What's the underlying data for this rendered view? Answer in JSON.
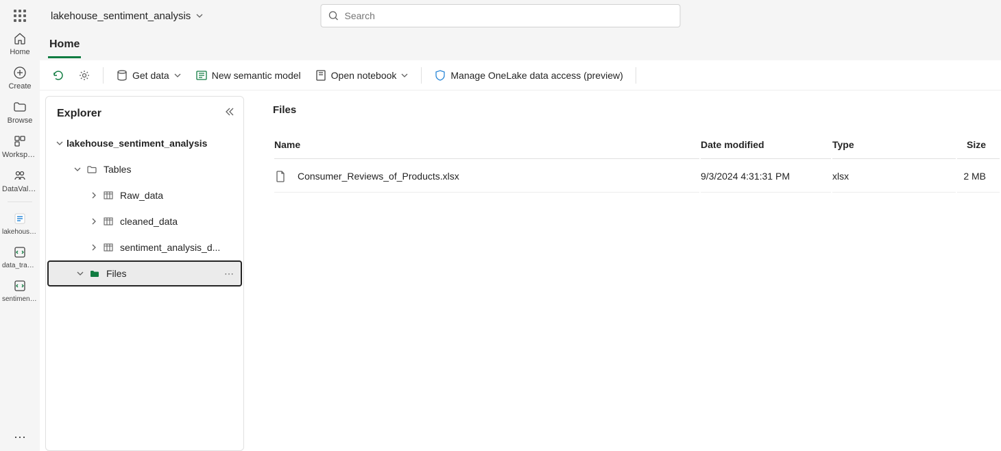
{
  "breadcrumb": {
    "title": "lakehouse_sentiment_analysis"
  },
  "search": {
    "placeholder": "Search"
  },
  "tabs": {
    "home": "Home"
  },
  "toolbar": {
    "get_data": "Get data",
    "new_semantic_model": "New semantic model",
    "open_notebook": "Open notebook",
    "manage_access": "Manage OneLake data access (preview)"
  },
  "leftrail": {
    "home": "Home",
    "create": "Create",
    "browse": "Browse",
    "workspaces": "Workspaces",
    "datavalue": "DataValue_Workspace",
    "lakehouse": "lakehouse_sentiment_...",
    "data_transformation": "data_transformation",
    "sentiment_analysis": "sentiment_analysis"
  },
  "explorer": {
    "title": "Explorer",
    "root": "lakehouse_sentiment_analysis",
    "tables_label": "Tables",
    "tables": [
      "Raw_data",
      "cleaned_data",
      "sentiment_analysis_d..."
    ],
    "files_label": "Files"
  },
  "filepane": {
    "title": "Files",
    "columns": {
      "name": "Name",
      "date": "Date modified",
      "type": "Type",
      "size": "Size"
    },
    "rows": [
      {
        "name": "Consumer_Reviews_of_Products.xlsx",
        "date": "9/3/2024 4:31:31 PM",
        "type": "xlsx",
        "size": "2 MB"
      }
    ]
  }
}
